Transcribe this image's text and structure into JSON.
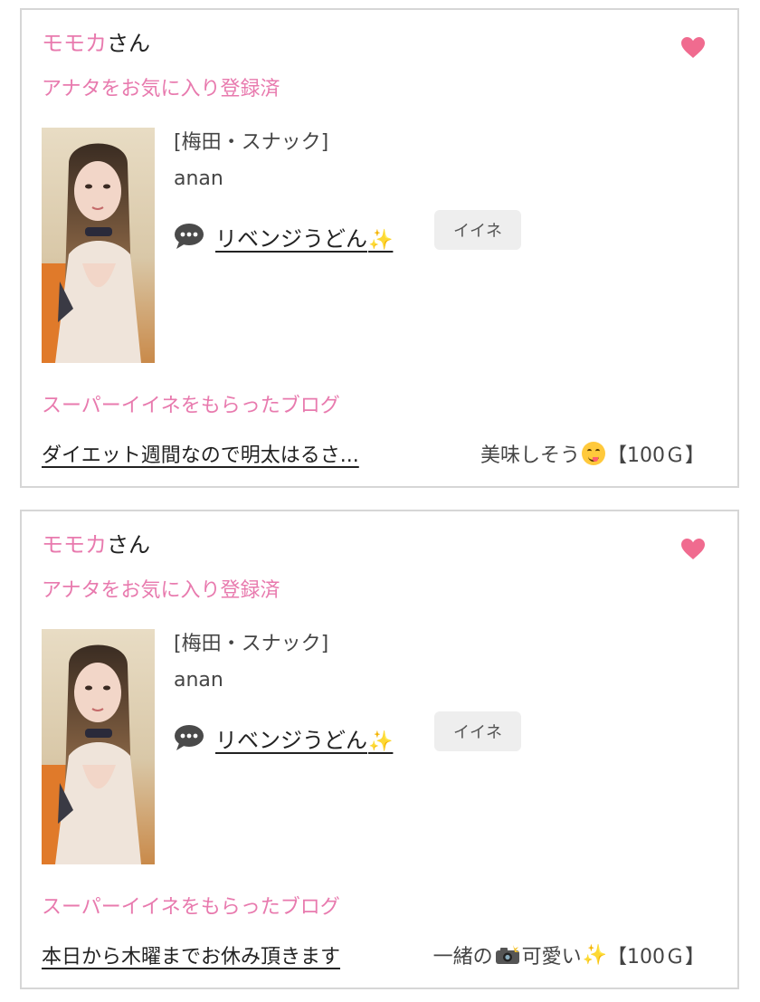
{
  "cards": [
    {
      "user_name": "モモカ",
      "user_suffix": "さん",
      "fav_status": "アナタをお気に入り登録済",
      "shop": "[梅田・スナック]",
      "cast_name": "anan",
      "blog_title": "リベンジうどん",
      "like_label": "イイネ",
      "super_like_heading": "スーパーイイネをもらったブログ",
      "super_blog_title": "ダイエット週間なので明太はるさ...",
      "super_comment_prefix": "美味しそう",
      "super_comment_suffix": "",
      "points": "【100Ｇ】"
    },
    {
      "user_name": "モモカ",
      "user_suffix": "さん",
      "fav_status": "アナタをお気に入り登録済",
      "shop": "[梅田・スナック]",
      "cast_name": "anan",
      "blog_title": "リベンジうどん",
      "like_label": "イイネ",
      "super_like_heading": "スーパーイイネをもらったブログ",
      "super_blog_title": "本日から木曜までお休み頂きます",
      "super_comment_prefix": "一緒の",
      "super_comment_suffix": "可愛い",
      "points": "【100Ｇ】"
    }
  ],
  "icons": {
    "favorite": "heart-icon",
    "blog": "speech-bubble-icon",
    "sparkle": "sparkles-emoji",
    "face": "yum-face-emoji",
    "camera": "camera-flash-emoji"
  },
  "colors": {
    "accent_pink": "#e87aae",
    "heart": "#f06b8f",
    "like_button_bg": "#eeeeee",
    "card_border": "#d6d6d6"
  }
}
